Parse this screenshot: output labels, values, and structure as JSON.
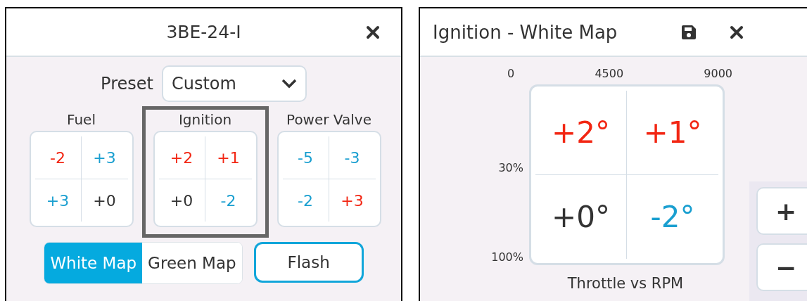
{
  "left_window": {
    "title": "3BE-24-I",
    "preset": {
      "label": "Preset",
      "value": "Custom"
    },
    "groups": [
      {
        "label": "Fuel",
        "selected": false,
        "cells": [
          {
            "value": "-2",
            "color": "#f22613"
          },
          {
            "value": "+3",
            "color": "#1a9fd0"
          },
          {
            "value": "+3",
            "color": "#1a9fd0"
          },
          {
            "value": "+0",
            "color": "#333333"
          }
        ]
      },
      {
        "label": "Ignition",
        "selected": true,
        "cells": [
          {
            "value": "+2",
            "color": "#f22613"
          },
          {
            "value": "+1",
            "color": "#f22613"
          },
          {
            "value": "+0",
            "color": "#333333"
          },
          {
            "value": "-2",
            "color": "#1a9fd0"
          }
        ]
      },
      {
        "label": "Power Valve",
        "selected": false,
        "cells": [
          {
            "value": "-5",
            "color": "#1a9fd0"
          },
          {
            "value": "-3",
            "color": "#1a9fd0"
          },
          {
            "value": "-2",
            "color": "#1a9fd0"
          },
          {
            "value": "+3",
            "color": "#f22613"
          }
        ]
      }
    ],
    "map_tabs": [
      {
        "label": "White Map",
        "selected": true
      },
      {
        "label": "Green Map",
        "selected": false
      }
    ],
    "flash_button": "Flash"
  },
  "right_window": {
    "title": "Ignition - White Map",
    "x_labels": [
      "0",
      "4500",
      "9000"
    ],
    "y_labels": [
      "30%",
      "100%"
    ],
    "cells": [
      {
        "value": "+2°",
        "color": "#f22613"
      },
      {
        "value": "+1°",
        "color": "#f22613"
      },
      {
        "value": "+0°",
        "color": "#333333"
      },
      {
        "value": "-2°",
        "color": "#1a9fd0"
      }
    ],
    "caption": "Throttle vs RPM",
    "buttons": [
      "+",
      "−"
    ]
  }
}
